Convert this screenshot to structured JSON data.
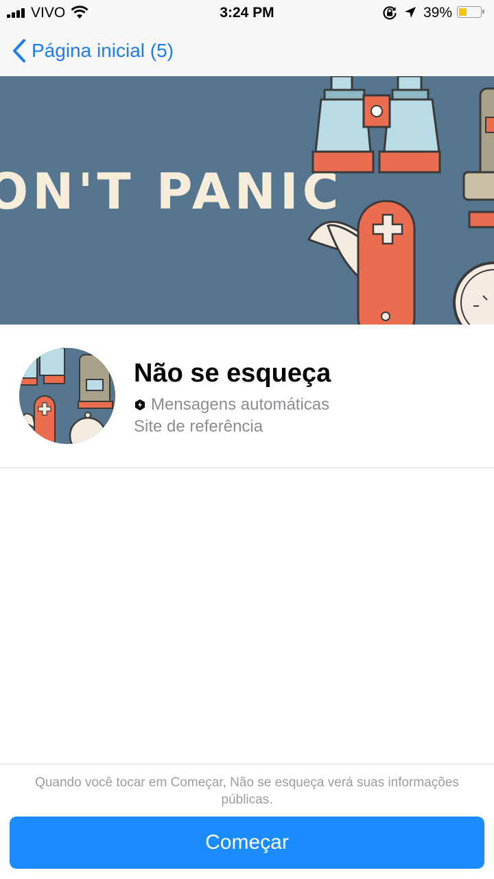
{
  "status_bar": {
    "carrier": "VIVO",
    "time": "3:24 PM",
    "battery_percent": "39%",
    "battery_level": 0.39,
    "icons": [
      "signal-icon",
      "wifi-icon",
      "orientation-lock-icon",
      "location-arrow-icon",
      "battery-icon"
    ]
  },
  "nav": {
    "back_label": "Página inicial (5)",
    "back_icon": "chevron-left-icon",
    "accent_color": "#1d7cf2"
  },
  "cover": {
    "text": "ON'T PANIC",
    "background_color": "#56758f"
  },
  "profile": {
    "name": "Não se esqueça",
    "category": "Mensagens automáticas",
    "category_icon": "automation-badge-icon",
    "subtitle": "Site de referência"
  },
  "footer": {
    "disclaimer": "Quando você tocar em Começar, Não se esqueça verá suas informações públicas.",
    "start_button": "Começar",
    "button_color": "#1a8cff"
  }
}
